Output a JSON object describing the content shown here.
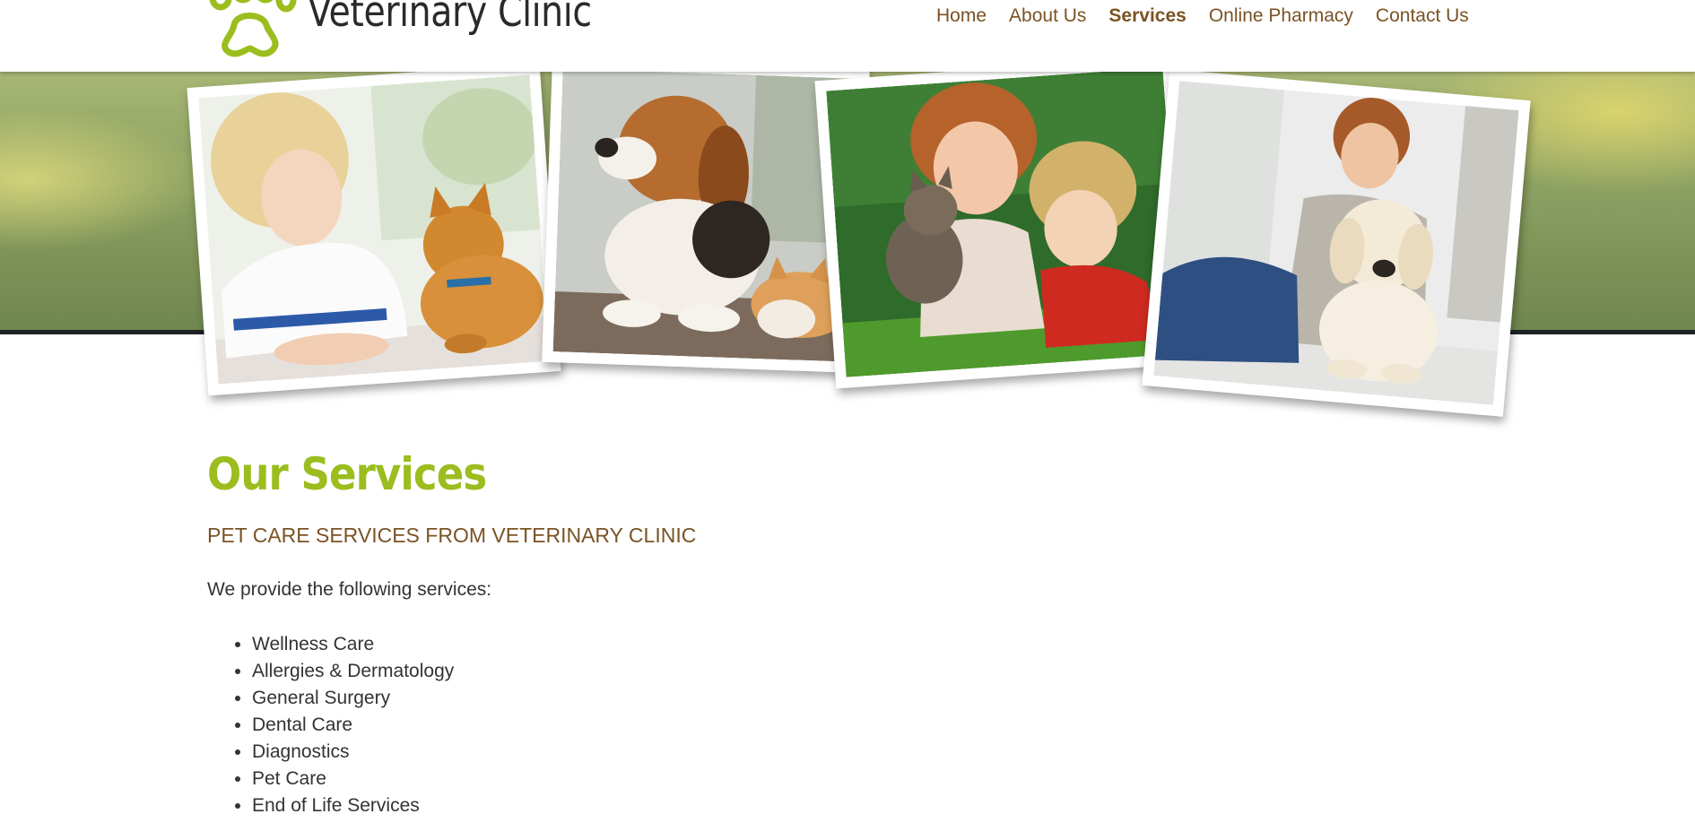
{
  "header": {
    "logo_text": "Veterinary Clinic",
    "nav": [
      {
        "label": "Home",
        "active": false
      },
      {
        "label": "About Us",
        "active": false
      },
      {
        "label": "Services",
        "active": true
      },
      {
        "label": "Online Pharmacy",
        "active": false
      },
      {
        "label": "Contact Us",
        "active": false
      }
    ]
  },
  "banner": {
    "photos": [
      {
        "name": "child-with-cat-photo"
      },
      {
        "name": "beagle-and-cat-photo"
      },
      {
        "name": "woman-child-kitten-photo"
      },
      {
        "name": "man-with-golden-retriever-photo"
      }
    ]
  },
  "main": {
    "title": "Our Services",
    "subtitle": "PET CARE SERVICES FROM VETERINARY CLINIC",
    "intro": "We provide the following services:",
    "services": [
      "Wellness Care",
      "Allergies & Dermatology",
      "General Surgery",
      "Dental Care",
      "Diagnostics",
      "Pet Care",
      "End of Life Services"
    ]
  },
  "colors": {
    "accent_green": "#9bbd1e",
    "nav_brown": "#7a5324",
    "banner_green": "#899e60",
    "text_dark": "#333333"
  }
}
